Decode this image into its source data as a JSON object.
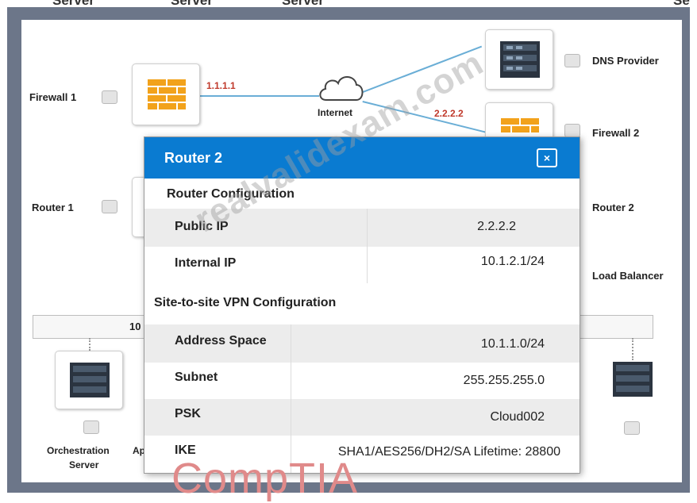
{
  "top_labels": [
    "Server",
    "Server",
    "Server",
    "Se"
  ],
  "diagram": {
    "firewall1_label": "Firewall 1",
    "internet_label": "Internet",
    "ip_left": "1.1.1.1",
    "ip_right": "2.2.2.2",
    "dns_label": "DNS Provider",
    "firewall2_label": "Firewall 2",
    "router1_label": "Router 1",
    "router2_label": "Router 2",
    "load_balancer_label": "Load Balancer",
    "bar_label": "10",
    "orchestration_label_1": "Orchestration",
    "orchestration_label_2": "Server",
    "partial_label": "Ap"
  },
  "modal": {
    "title": "Router 2",
    "close_symbol": "×",
    "router_section": "Router Configuration",
    "router_rows": [
      {
        "key": "Public IP",
        "value": "2.2.2.2"
      },
      {
        "key": "Internal IP",
        "value": "10.1.2.1/24"
      }
    ],
    "vpn_section": "Site-to-site VPN Configuration",
    "vpn_rows": [
      {
        "key": "Address Space",
        "value": "10.1.1.0/24"
      },
      {
        "key": "Subnet",
        "value": "255.255.255.0"
      },
      {
        "key": "PSK",
        "value": "Cloud002"
      },
      {
        "key": "IKE",
        "value": "SHA1/AES256/DH2/SA Lifetime: 28800"
      }
    ]
  },
  "watermark": "realvalidexam.com",
  "brand": "CompTIA",
  "colors": {
    "header_blue": "#0a7bd1",
    "frame": "#6c7689",
    "ip_red": "#c0392b",
    "line_blue": "#6aaed6"
  },
  "icons": [
    "firewall-icon",
    "cloud-icon",
    "server-icon",
    "close-icon"
  ]
}
